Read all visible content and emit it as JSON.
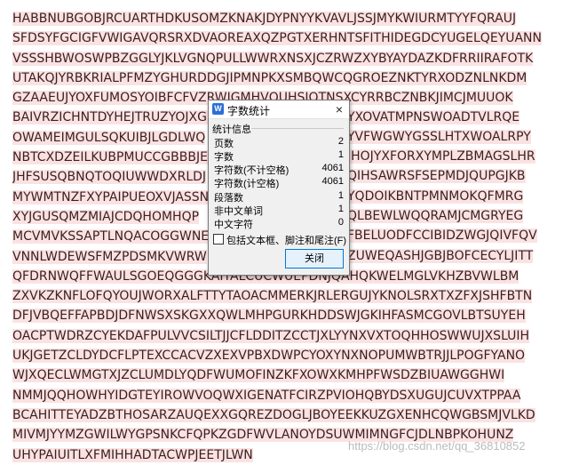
{
  "document": {
    "lines": [
      "HABBNUBGOBJRCUARTHDKUSOMZKNAKJDYPNYYKVAVLJSSJMYKWIURMTYYFQRAUJ",
      "SFDSYFGCIGFVWIGAVQRSRXDVAOREAXQZPGTXERHNTSFITHIDEGDCYUGELQEYUANN",
      "VSSSHBWOSWPBZGGLYJKLVGNQPULLWWRXNSXJCZRWZXYBYAYDAZKDFRRIIRAFOTK",
      "UTAKQJYRBKRIALPFMZYGHURDDGJIPMNPKXSMBQWCQGROEZNKTYRXODZNLNKDM",
      "GZAAEUJYOXFUMOSYOIBFCFVZRWJGMHVQUHSIQTNSXCYRRBCZNBKJIMCJMUUOK",
      "BAIVRZICHNTDYHEJTRUZYOJXGL",
      "OWAMEIMGULSQKUIBJLGDLWQ",
      "NBTCXDZEILKUBPMUCCGBBBJE",
      "JHFSUSQBNQTOQIUWWDXRLDJ",
      "MYWMTNZFXYPAIPUEOXVJASSN",
      "XYJGUSQMZMIAJCDQHOMHQP",
      "MCVMVKSSAPTLNQACOGGWNE",
      "VNNLWDEWSFMZPDSMKVWRW",
      "QFDRNWQFFWAULSGOEQGGGKAITALCUCWUEPDNJQAHQKWELMGLVKHZBVWLBM",
      "ZXVKZKNFLOFQYOUJWORXALFTTYTAOACMMERKJRLERGUJYKNOLSRXTXZFXJSHFBTN",
      "DFJVBQEFFAPBDJDFNWSXSKGXXQWLMHPGURKHDDSWJGKIHFASMCGOVLBTSUYEH",
      "OACPTWDRZCYEKDAFPULVVCSILTJJCFLDDITZCCTJXLYYNXVXTOQHHOSWWUJXSLUIH",
      "UKJGETZCLDYDCFLPTEXCCACVZXEXVPBXDWPCYOXYNXNOPUMWBTRJJLPOGFYANO",
      "WJXQECLWMGTXJZCLUMDLYQDFWUMOFINZKFXOWXKMHPFWSDZBIUAWGGHWI",
      "NMMJQQHOWHYIDGTEYIROWVOQWXIGENATFCIRZPVIOHQBYDSXUGUJCUVXTPPAA",
      "BCAHITTEYADZBTHOSARZAUQEXXGQREZDOGLJBOYEEKKUZGXENHCQWGBSMJVLKD",
      "MIVMJYYMZGWILWYGPSNKCFQPKZGDFWVLANOYDSUWMIMNGFCJDLNBPKOHUNZ",
      "UHYPAIUITLXFMIHHADTACWPJEETJLWN"
    ],
    "right_fragments": [
      "YXOVATMPNSWOADTVLRQE",
      "YVFWGWYGSSLHTXWOALRPY",
      "IHOJYXFORXYMPLZBMAGSLHR",
      "QIHSAWRSFSEPMDJQUPGJKB",
      "YQDOIKBNTPMNMOKQFMRG",
      "QLBEWLWQQRAMJCMGRYEG",
      "FBELUODFCCIBIDZWGJQIVFQV",
      "ZUWEQASHJGBJBOFCECYLJITT"
    ]
  },
  "dialog": {
    "app_icon": "W",
    "title": "字数统计",
    "close_glyph": "×",
    "group_label": "统计信息",
    "stats": [
      {
        "label": "页数",
        "value": "2"
      },
      {
        "label": "字数",
        "value": "1"
      },
      {
        "label": "字符数(不计空格)",
        "value": "4061"
      },
      {
        "label": "字符数(计空格)",
        "value": "4061"
      },
      {
        "label": "段落数",
        "value": "1"
      },
      {
        "label": "非中文单词",
        "value": "1"
      },
      {
        "label": "中文字符",
        "value": "0"
      }
    ],
    "checkbox_label": "包括文本框、脚注和尾注(F)",
    "checkbox_checked": false,
    "close_button_label": "关闭"
  },
  "watermark": "https://blog.csdn.net/qq_36810852"
}
